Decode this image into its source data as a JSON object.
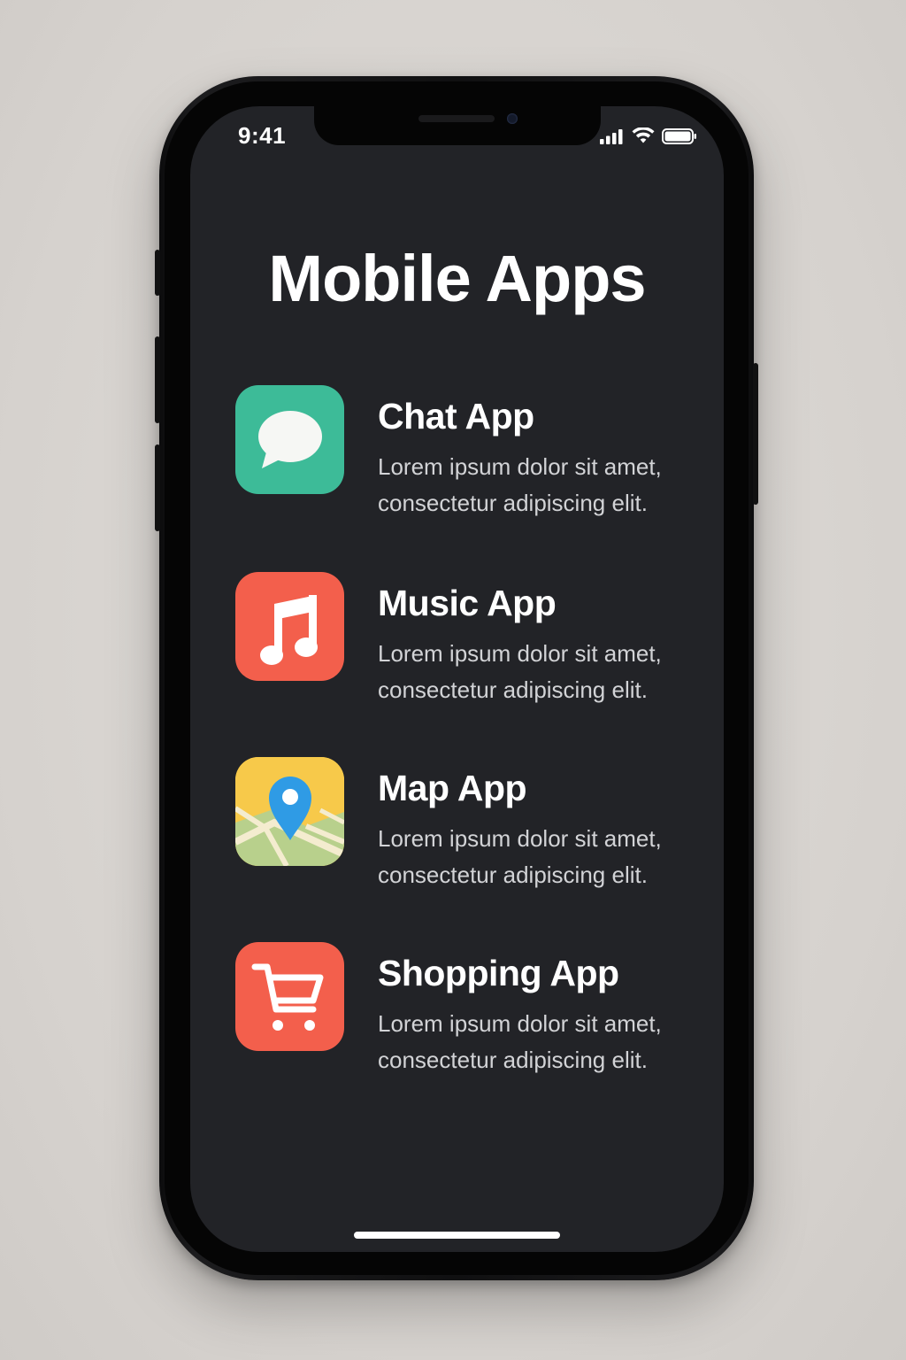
{
  "status_bar": {
    "time": "9:41",
    "icons": [
      "signal-icon",
      "wifi-icon",
      "battery-icon"
    ]
  },
  "page": {
    "title": "Mobile Apps"
  },
  "apps": [
    {
      "name": "Chat App",
      "description_line1": "Lorem ipsum dolor sit amet,",
      "description_line2": "consectetur adipiscing elit.",
      "icon": "chat-bubble-icon",
      "color": "#3dbb98"
    },
    {
      "name": "Music App",
      "description_line1": "Lorem ipsum dolor sit amet,",
      "description_line2": "consectetur adipiscing elit.",
      "icon": "music-note-icon",
      "color": "#f35f4c"
    },
    {
      "name": "Map App",
      "description_line1": "Lorem ipsum dolor sit amet,",
      "description_line2": "consectetur adipiscing elit.",
      "icon": "map-pin-icon",
      "color": "#f7c94a"
    },
    {
      "name": "Shopping App",
      "description_line1": "Lorem ipsum dolor sit amet,",
      "description_line2": "consectetur adipiscing elit.",
      "icon": "shopping-cart-icon",
      "color": "#f35f4c"
    }
  ],
  "colors": {
    "screen_background": "#222327",
    "phone_frame": "#101011",
    "page_background": "#d8d4d0"
  }
}
